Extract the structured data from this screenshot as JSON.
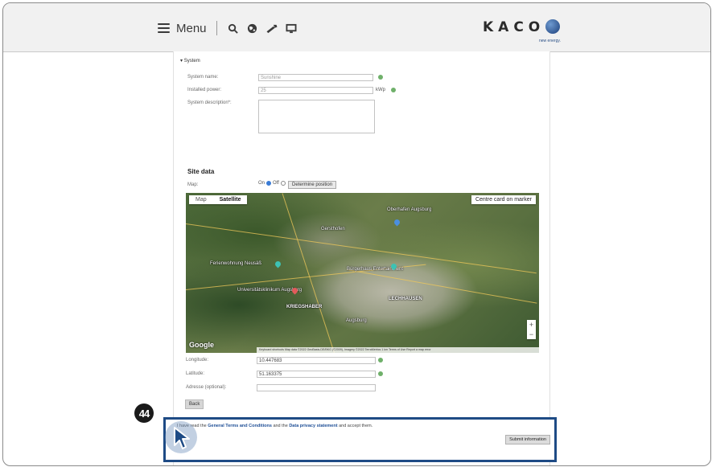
{
  "topbar": {
    "menu_label": "Menu",
    "icons": [
      "menu-icon",
      "search-icon",
      "globe-icon",
      "tools-icon",
      "monitor-icon"
    ],
    "logo_text": "KACO",
    "logo_tagline": "new energy."
  },
  "system": {
    "section_label": "System",
    "name_label": "System name:",
    "name_value": "Sunshine",
    "power_label": "Installed power:",
    "power_value": "25",
    "power_unit": "kWp",
    "description_label": "System description*:"
  },
  "site": {
    "title": "Site data",
    "map_label": "Map:",
    "map_on": "On",
    "map_off": "Off",
    "determine_position": "Determine position"
  },
  "map": {
    "tab_map": "Map",
    "tab_satellite": "Satellite",
    "centre_button": "Centre card on marker",
    "places": [
      "Oberhafen Augsburg",
      "Gersthofen",
      "Ferienwohnung Neusäß",
      "Universitätsklinikum Augsburg",
      "KRIEGSHABER",
      "LECHHAUSEN",
      "Augsburg",
      "Bürgerhaus Entertainment"
    ],
    "zoom_in": "+",
    "zoom_out": "−",
    "google_label": "Google",
    "attribution": "Keyboard shortcuts   Map data ©2022 GeoBasis-DE/BKG (©2009), Imagery ©2022 TerraMetrics   1 km   Terms of Use   Report a map error"
  },
  "coords": {
    "longitude_label": "Longitude:",
    "longitude_value": "10.447683",
    "latitude_label": "Latitude:",
    "latitude_value": "51.163375",
    "address_label": "Adresse (optional):",
    "address_value": ""
  },
  "back_button": "Back",
  "step_badge": "44",
  "terms": {
    "prefix": "I have read the",
    "link1": "General Terms and Conditions",
    "middle": "and the",
    "link2": "Data privacy statement",
    "suffix": "and accept them."
  },
  "submit_button": "Submit information",
  "colors": {
    "highlight_border": "#1e4b85",
    "check_green": "#6fb06a",
    "link_blue": "#1f4f96"
  }
}
